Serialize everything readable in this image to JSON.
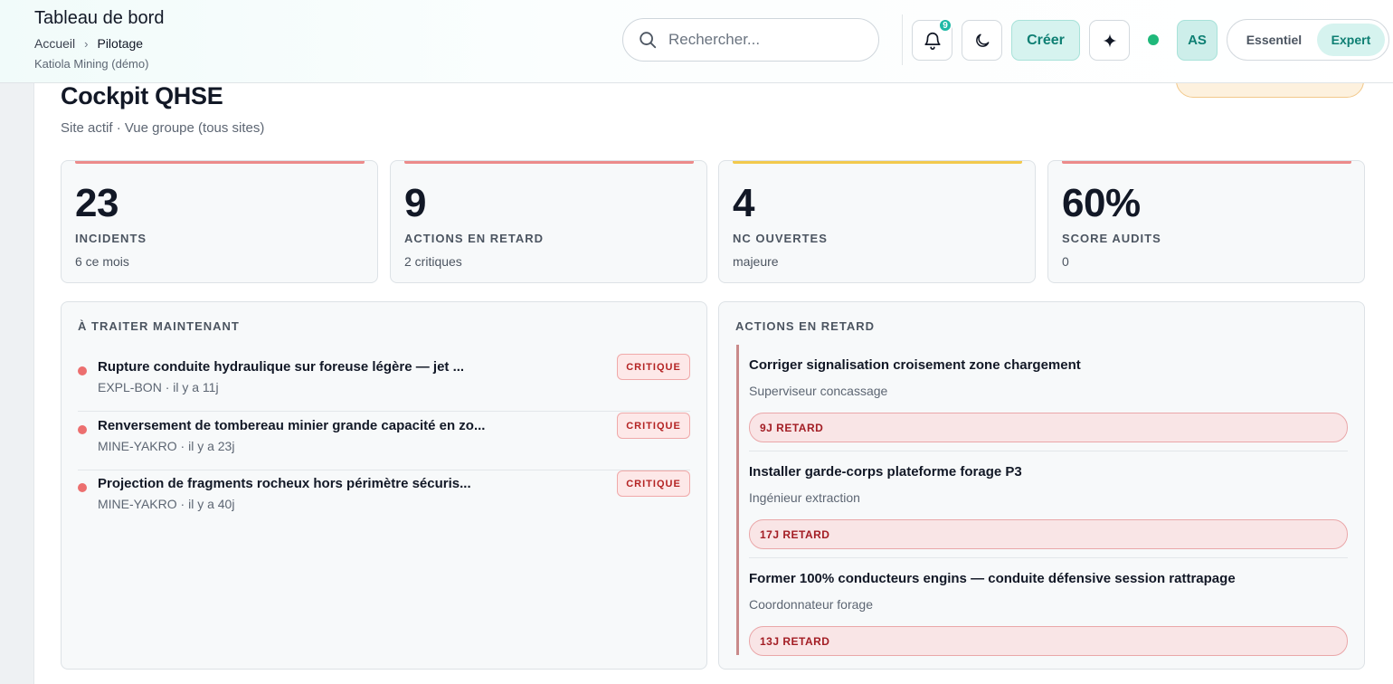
{
  "header": {
    "title": "Tableau de bord",
    "breadcrumb": [
      "Accueil",
      "Pilotage"
    ],
    "organization": "Katiola Mining (démo)",
    "search_placeholder": "Rechercher...",
    "notifications_count": "9",
    "create_label": "Créer",
    "avatar_initials": "AS",
    "mode_options": [
      "Essentiel",
      "Expert"
    ],
    "mode_selected": "Expert",
    "icons": [
      "search-icon",
      "bell-icon",
      "moon-icon",
      "sparkle-icon"
    ]
  },
  "page": {
    "title": "Cockpit QHSE",
    "subtitle": "Site actif · Vue groupe (tous sites)"
  },
  "kpis": [
    {
      "value": "23",
      "label": "INCIDENTS",
      "sub": "6 ce mois",
      "accent": "#ec8a8a"
    },
    {
      "value": "9",
      "label": "ACTIONS EN RETARD",
      "sub": "2 critiques",
      "accent": "#ec8a8a"
    },
    {
      "value": "4",
      "label": "NC OUVERTES",
      "sub": "majeure",
      "accent": "#f2c94c"
    },
    {
      "value": "60%",
      "label": "SCORE AUDITS",
      "sub": "0",
      "accent": "#ec8a8a"
    }
  ],
  "to_handle": {
    "title": "À TRAITER MAINTENANT",
    "items": [
      {
        "title": "Rupture conduite hydraulique sur foreuse légère — jet ...",
        "meta": "EXPL-BON · il y a 11j",
        "badge": "CRITIQUE"
      },
      {
        "title": "Renversement de tombereau minier grande capacité en zo...",
        "meta": "MINE-YAKRO · il y a 23j",
        "badge": "CRITIQUE"
      },
      {
        "title": "Projection de fragments rocheux hors périmètre sécuris...",
        "meta": "MINE-YAKRO · il y a 40j",
        "badge": "CRITIQUE"
      }
    ]
  },
  "late_actions": {
    "title": "ACTIONS EN RETARD",
    "items": [
      {
        "title": "Corriger signalisation croisement zone chargement",
        "owner": "Superviseur concassage",
        "delay": "9J RETARD"
      },
      {
        "title": "Installer garde-corps plateforme forage P3",
        "owner": "Ingénieur extraction",
        "delay": "17J RETARD"
      },
      {
        "title": "Former 100% conducteurs engins — conduite défensive session rattrapage",
        "owner": "Coordonnateur forage",
        "delay": "13J RETARD"
      }
    ]
  },
  "colors": {
    "brand": "#0e7f73",
    "brand_soft": "#d6f3ef",
    "critical": "#b42323",
    "status_online": "#1fb87a"
  }
}
